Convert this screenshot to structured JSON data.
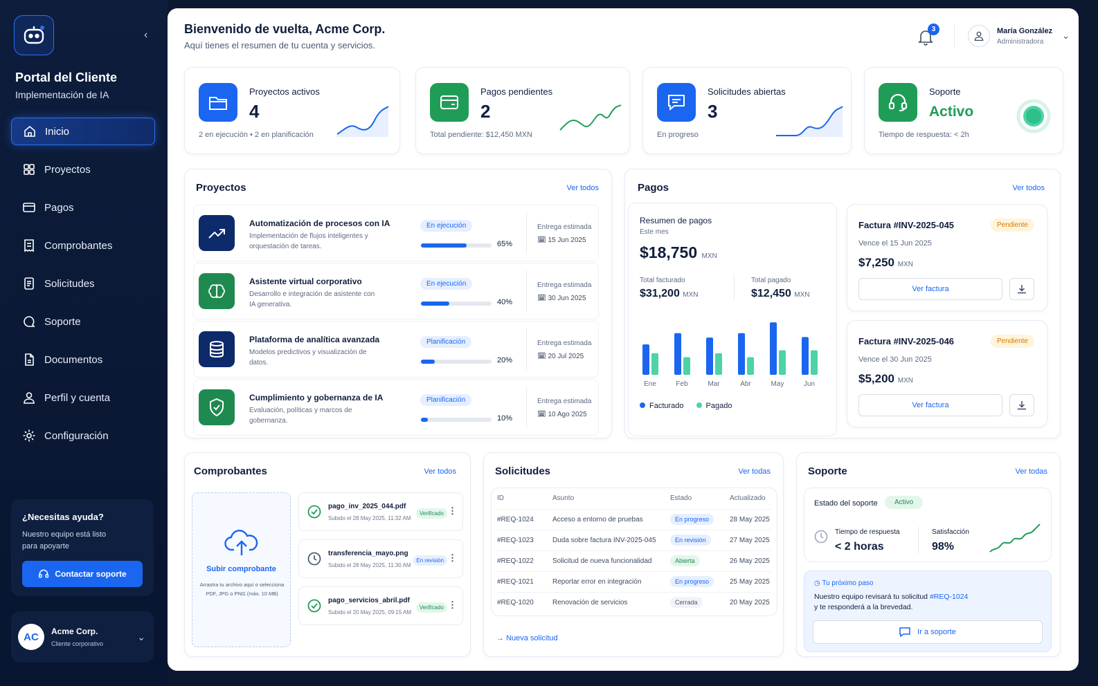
{
  "sidebar": {
    "title": "Portal del Cliente",
    "subtitle": "Implementación de IA",
    "items": [
      {
        "label": "Inicio",
        "icon": "home-icon"
      },
      {
        "label": "Proyectos",
        "icon": "projects-icon"
      },
      {
        "label": "Pagos",
        "icon": "card-icon"
      },
      {
        "label": "Comprobantes",
        "icon": "receipt-icon"
      },
      {
        "label": "Solicitudes",
        "icon": "file-icon"
      },
      {
        "label": "Soporte",
        "icon": "chat-icon"
      },
      {
        "label": "Documentos",
        "icon": "document-icon"
      },
      {
        "label": "Perfil y cuenta",
        "icon": "user-icon"
      },
      {
        "label": "Configuración",
        "icon": "gear-icon"
      }
    ],
    "help": {
      "title": "¿Necesitas ayuda?",
      "text": "Nuestro equipo está listo para apoyarte",
      "button": "Contactar soporte"
    },
    "account": {
      "initials": "AC",
      "name": "Acme Corp.",
      "type": "Cliente corporativo"
    }
  },
  "header": {
    "title": "Bienvenido de vuelta, Acme Corp.",
    "subtitle": "Aquí tienes el resumen de tu cuenta y servicios.",
    "notifications": "3",
    "user_name": "María González",
    "user_role": "Administradora"
  },
  "stats": [
    {
      "label": "Proyectos activos",
      "value": "4",
      "footer": "2 en ejecución • 2 en planificación",
      "color": "#1a66f0"
    },
    {
      "label": "Pagos pendientes",
      "value": "2",
      "footer": "Total pendiente: $12,450 MXN",
      "color": "#1f9d57"
    },
    {
      "label": "Solicitudes abiertas",
      "value": "3",
      "footer": "En progreso",
      "color": "#1a66f0"
    },
    {
      "label": "Soporte",
      "value": "Activo",
      "footer": "Tiempo de respuesta: < 2h",
      "color": "#1f9d57"
    }
  ],
  "projects": {
    "title": "Proyectos",
    "link": "Ver todos",
    "delivery_label": "Entrega estimada",
    "rows": [
      {
        "name": "Automatización de procesos con IA",
        "desc": "Implementación de flujos inteligentes y orquestación de tareas.",
        "status": "En ejecución",
        "progress": "65%",
        "date": "15 Jun 2025"
      },
      {
        "name": "Asistente virtual corporativo",
        "desc": "Desarrollo e integración de asistente con IA generativa.",
        "status": "En ejecución",
        "progress": "40%",
        "date": "30 Jun 2025"
      },
      {
        "name": "Plataforma de analítica avanzada",
        "desc": "Modelos predictivos y visualización de datos.",
        "status": "Planificación",
        "progress": "20%",
        "date": "20 Jul 2025"
      },
      {
        "name": "Cumplimiento y gobernanza de IA",
        "desc": "Evaluación, políticas y marcos de gobernanza.",
        "status": "Planificación",
        "progress": "10%",
        "date": "10 Ago 2025"
      }
    ]
  },
  "payments": {
    "title": "Pagos",
    "link": "Ver todos",
    "summary": "Resumen de pagos",
    "period": "Este mes",
    "total": "$18,750",
    "currency": "MXN",
    "billed_label": "Total facturado",
    "billed": "$31,200",
    "paid_label": "Total pagado",
    "paid": "$12,450",
    "legend_billed": "Facturado",
    "legend_paid": "Pagado",
    "invoices": [
      {
        "id": "Factura #INV-2025-045",
        "status": "Pendiente",
        "due": "Vence el 15 Jun 2025",
        "amount": "$7,250",
        "button": "Ver factura"
      },
      {
        "id": "Factura #INV-2025-046",
        "status": "Pendiente",
        "due": "Vence el 30 Jun 2025",
        "amount": "$5,200",
        "button": "Ver factura"
      }
    ]
  },
  "chart_data": {
    "type": "bar",
    "categories": [
      "Ene",
      "Feb",
      "Mar",
      "Abr",
      "May",
      "Jun"
    ],
    "series": [
      {
        "name": "Facturado",
        "values": [
          62,
          85,
          76,
          85,
          107,
          77
        ]
      },
      {
        "name": "Pagado",
        "values": [
          44,
          36,
          44,
          36,
          50,
          50
        ]
      }
    ],
    "colors": [
      "#1a66f0",
      "#4cd3a6"
    ]
  },
  "receipts": {
    "title": "Comprobantes",
    "link": "Ver todos",
    "upload_title": "Subir comprobante",
    "upload_text": "Arrastra tu archivo aquí o selecciona PDF, JPG o PNG (máx. 10 MB)",
    "files": [
      {
        "name": "pago_inv_2025_044.pdf",
        "meta": "Subido el 28 May 2025, 11:32 AM",
        "status": "Verificado"
      },
      {
        "name": "transferencia_mayo.png",
        "meta": "Subido el 28 May 2025, 11:30 AM",
        "status": "En revisión"
      },
      {
        "name": "pago_servicios_abril.pdf",
        "meta": "Subido el 20 May 2025, 09:15 AM",
        "status": "Verificado"
      }
    ]
  },
  "requests": {
    "title": "Solicitudes",
    "link": "Ver todas",
    "headers": [
      "ID",
      "Asunto",
      "Estado",
      "Actualizado"
    ],
    "new": "Nueva solicitud",
    "rows": [
      {
        "id": "#REQ-1024",
        "subject": "Acceso a entorno de pruebas",
        "status": "En progreso",
        "date": "28 May 2025"
      },
      {
        "id": "#REQ-1023",
        "subject": "Duda sobre factura INV-2025-045",
        "status": "En revisión",
        "date": "27 May 2025"
      },
      {
        "id": "#REQ-1022",
        "subject": "Solicitud de nueva funcionalidad",
        "status": "Abierta",
        "date": "26 May 2025"
      },
      {
        "id": "#REQ-1021",
        "subject": "Reportar error en integración",
        "status": "En progreso",
        "date": "25 May 2025"
      },
      {
        "id": "#REQ-1020",
        "subject": "Renovación de servicios",
        "status": "Cerrada",
        "date": "20 May 2025"
      }
    ]
  },
  "support": {
    "title": "Soporte",
    "link": "Ver todas",
    "state_label": "Estado del soporte",
    "state": "Activo",
    "resp_label": "Tiempo de respuesta",
    "resp": "< 2 horas",
    "sat_label": "Satisfacción",
    "sat": "98%",
    "next_title": "Tu próximo paso",
    "next_text": "Nuestro equipo revisará tu solicitud",
    "next_ref": "#REQ-1024",
    "next_text2": "y te responderá a la brevedad.",
    "button": "Ir a soporte"
  }
}
